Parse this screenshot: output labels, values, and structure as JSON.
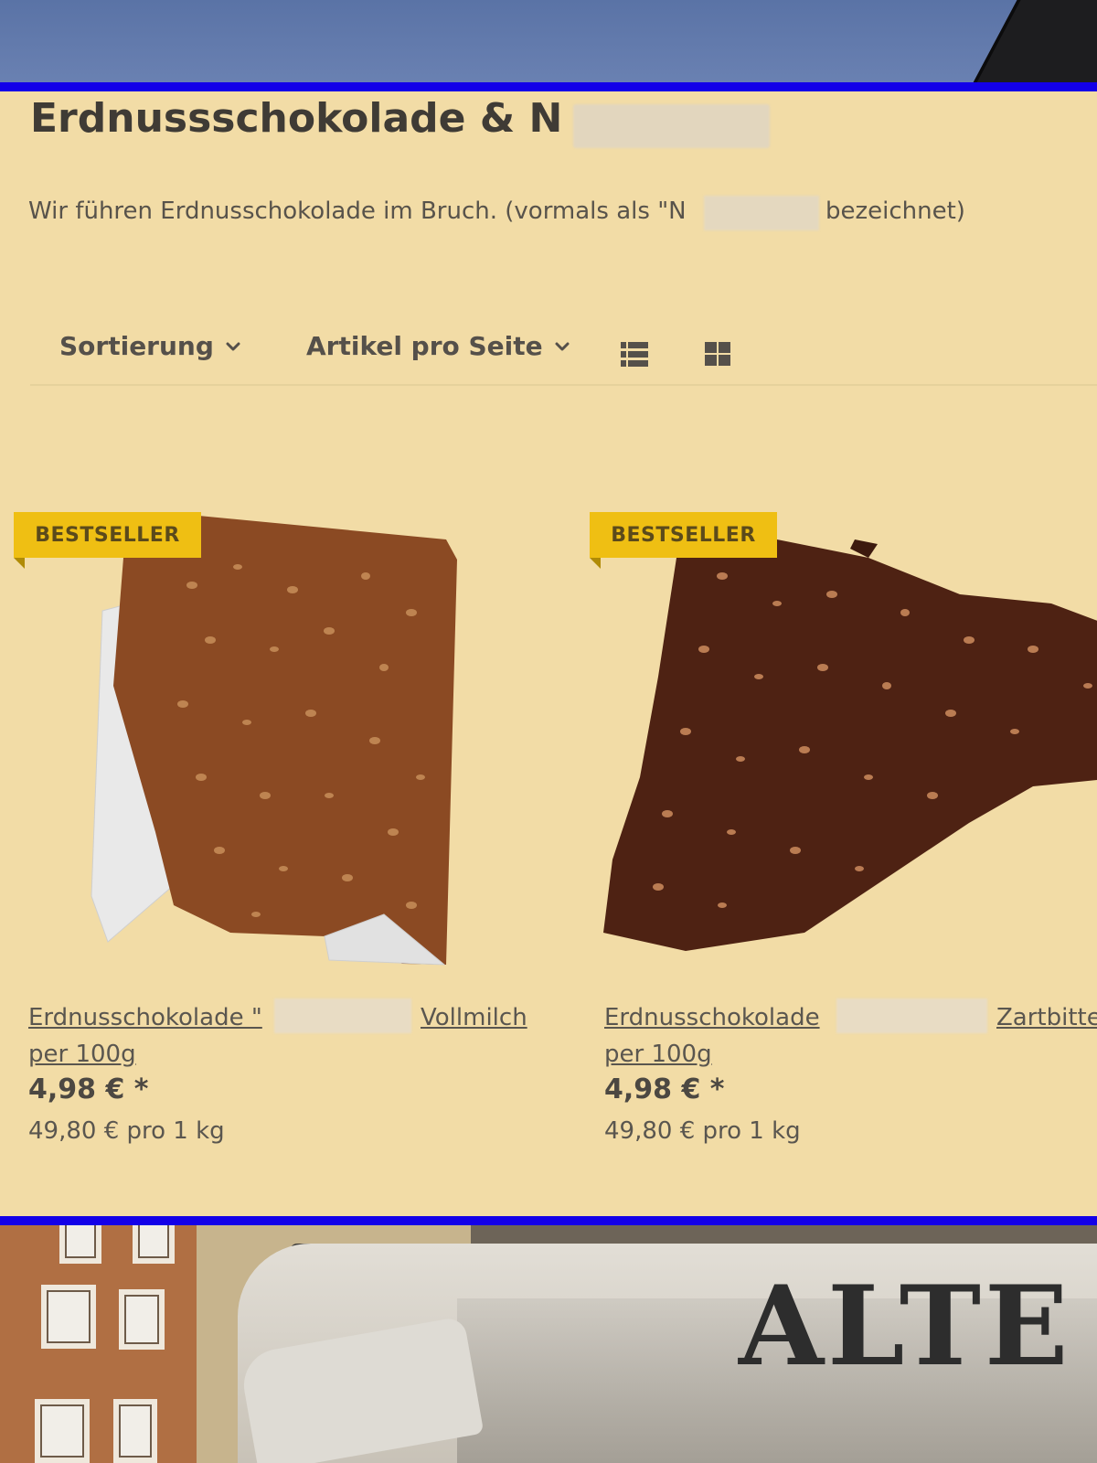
{
  "category": {
    "title": "Erdnussschokolade & N",
    "description_start": "Wir führen Erdnusschokolade im Bruch. (vormals als \"N",
    "description_end": "bezeichnet)"
  },
  "toolbar": {
    "sort_label": "Sortierung",
    "per_page_label": "Artikel pro Seite",
    "list_view_icon": "list-view-icon",
    "grid_view_icon": "grid-view-icon"
  },
  "products": [
    {
      "badge": "BESTSELLER",
      "name_start": "Erdnusschokolade \"",
      "name_end": "Vollmilch",
      "unit": "per 100g",
      "price": "4,98 € *",
      "base_price": "49,80 € pro 1 kg",
      "chocolate_color": "#8b4a23"
    },
    {
      "badge": "BESTSELLER",
      "name_start": "Erdnusschokolade",
      "name_end": "Zartbitter",
      "unit": "per 100g",
      "price": "4,98 € *",
      "base_price": "49,80 € pro 1 kg",
      "chocolate_color": "#4e2213"
    }
  ],
  "background": {
    "awning_text": "ALTE",
    "frame_color": "#1300e8",
    "shop_bg": "#f2dca6",
    "badge_color": "#efbf13"
  }
}
